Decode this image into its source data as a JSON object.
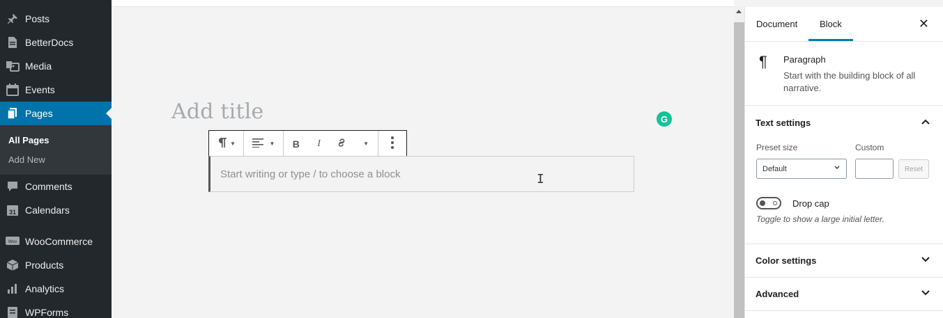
{
  "admin_menu": {
    "items": [
      {
        "label": "Posts",
        "icon": "pin-icon"
      },
      {
        "label": "BetterDocs",
        "icon": "docs-icon"
      },
      {
        "label": "Media",
        "icon": "media-icon"
      },
      {
        "label": "Events",
        "icon": "calendar-icon"
      },
      {
        "label": "Pages",
        "icon": "pages-icon",
        "active": true
      },
      {
        "label": "Comments",
        "icon": "comment-icon"
      },
      {
        "label": "Calendars",
        "icon": "calendar-31-icon"
      },
      {
        "label": "WooCommerce",
        "icon": "woo-icon"
      },
      {
        "label": "Products",
        "icon": "box-icon"
      },
      {
        "label": "Analytics",
        "icon": "bar-chart-icon"
      },
      {
        "label": "WPForms",
        "icon": "form-icon"
      }
    ],
    "submenu": [
      {
        "label": "All Pages",
        "current": true
      },
      {
        "label": "Add New"
      }
    ],
    "calendar_day": "31",
    "woo_badge": "Woo"
  },
  "editor": {
    "title_placeholder": "Add title",
    "block_placeholder": "Start writing or type / to choose a block",
    "grammarly_glyph": "G",
    "toolbar": {
      "block_type_icon": "paragraph-icon",
      "align_icon": "align-left-icon",
      "bold_label": "B",
      "italic_label": "I",
      "link_icon": "link-icon",
      "more_icon": "more-vertical-icon"
    }
  },
  "settings_sidebar": {
    "tabs": [
      {
        "label": "Document"
      },
      {
        "label": "Block",
        "active": true
      }
    ],
    "close_glyph": "✕",
    "block_card": {
      "icon": "¶",
      "title": "Paragraph",
      "description": "Start with the building block of all narrative."
    },
    "text_settings": {
      "title": "Text settings",
      "expanded": true,
      "preset_size_label": "Preset size",
      "custom_label": "Custom",
      "preset_value": "Default",
      "custom_value": "",
      "reset_label": "Reset",
      "drop_cap_label": "Drop cap",
      "drop_cap_enabled": false,
      "drop_cap_help": "Toggle to show a large initial letter."
    },
    "panels": [
      {
        "title": "Color settings",
        "expanded": false
      },
      {
        "title": "Advanced",
        "expanded": false
      }
    ]
  },
  "colors": {
    "sidebar_bg": "#23282d",
    "active_blue": "#0073aa",
    "tab_accent": "#007cba",
    "grammarly": "#15c39a"
  }
}
